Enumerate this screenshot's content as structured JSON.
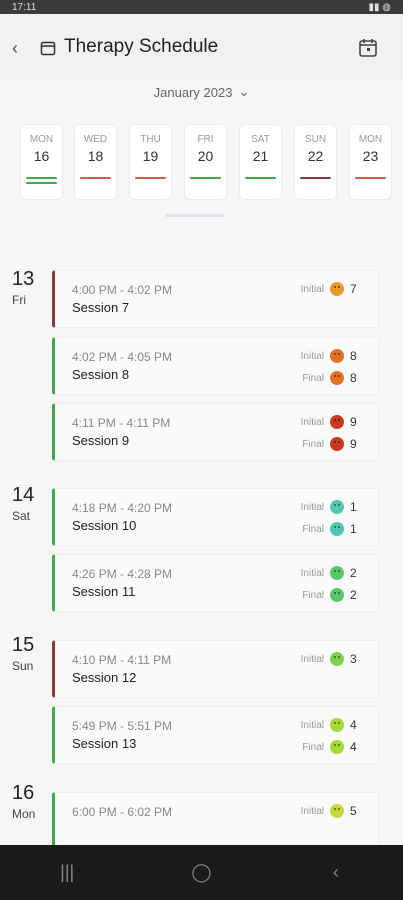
{
  "status_bar": {
    "time": "17:11"
  },
  "app_bar": {
    "title": "Therapy Schedule"
  },
  "month": {
    "label": "January 2023",
    "chevron": "⌄"
  },
  "colors": {
    "green": "#41a84a",
    "red": "#d25b4b",
    "dark_red": "#8a3b3b",
    "orange": "#e89a2a",
    "teal": "#52c6b1",
    "lime": "#7fd04a",
    "red_dark": "#c73a1f"
  },
  "date_strip": [
    {
      "wd": "MON",
      "dn": "16",
      "bars": [
        "#41a84a",
        "#41a84a"
      ]
    },
    {
      "wd": "WED",
      "dn": "18",
      "bars": [
        "#d25b4b"
      ]
    },
    {
      "wd": "THU",
      "dn": "19",
      "bars": [
        "#d25b4b"
      ]
    },
    {
      "wd": "FRI",
      "dn": "20",
      "bars": [
        "#41a84a"
      ]
    },
    {
      "wd": "SAT",
      "dn": "21",
      "bars": [
        "#41a84a"
      ]
    },
    {
      "wd": "SUN",
      "dn": "22",
      "bars": [
        "#8a3b3b"
      ]
    },
    {
      "wd": "MON",
      "dn": "23",
      "bars": [
        "#d25b4b"
      ]
    }
  ],
  "days": [
    {
      "num": "13",
      "wkd": "Fri"
    },
    {
      "num": "14",
      "wkd": "Sat"
    },
    {
      "num": "15",
      "wkd": "Sun"
    },
    {
      "num": "16",
      "wkd": "Mon"
    }
  ],
  "labels": {
    "initial": "Initial",
    "final": "Final"
  },
  "sessions": [
    {
      "time": "4:00 PM - 4:02 PM",
      "name": "Session 7",
      "accent": "red",
      "initial": {
        "value": "7",
        "color": "#e89a2a"
      }
    },
    {
      "time": "4:02 PM - 4:05 PM",
      "name": "Session 8",
      "accent": "green",
      "initial": {
        "value": "8",
        "color": "#e0722a"
      },
      "final": {
        "value": "8",
        "color": "#e0722a"
      }
    },
    {
      "time": "4:11 PM - 4:11 PM",
      "name": "Session 9",
      "accent": "green",
      "initial": {
        "value": "9",
        "color": "#c73a1f"
      },
      "final": {
        "value": "9",
        "color": "#c73a1f"
      }
    },
    {
      "time": "4:18 PM - 4:20 PM",
      "name": "Session 10",
      "accent": "green",
      "initial": {
        "value": "1",
        "color": "#52c6b1"
      },
      "final": {
        "value": "1",
        "color": "#52c6b1"
      }
    },
    {
      "time": "4:26 PM - 4:28 PM",
      "name": "Session 11",
      "accent": "green",
      "initial": {
        "value": "2",
        "color": "#5fc56a"
      },
      "final": {
        "value": "2",
        "color": "#5fc56a"
      }
    },
    {
      "time": "4:10 PM - 4:11 PM",
      "name": "Session 12",
      "accent": "red",
      "initial": {
        "value": "3",
        "color": "#7fd04a"
      }
    },
    {
      "time": "5:49 PM - 5:51 PM",
      "name": "Session 13",
      "accent": "green",
      "initial": {
        "value": "4",
        "color": "#a6d83a"
      },
      "final": {
        "value": "4",
        "color": "#a6d83a"
      }
    },
    {
      "time": "6:00 PM - 6:02 PM",
      "name": "",
      "accent": "green",
      "initial": {
        "value": "5",
        "color": "#c8d83a"
      }
    }
  ]
}
